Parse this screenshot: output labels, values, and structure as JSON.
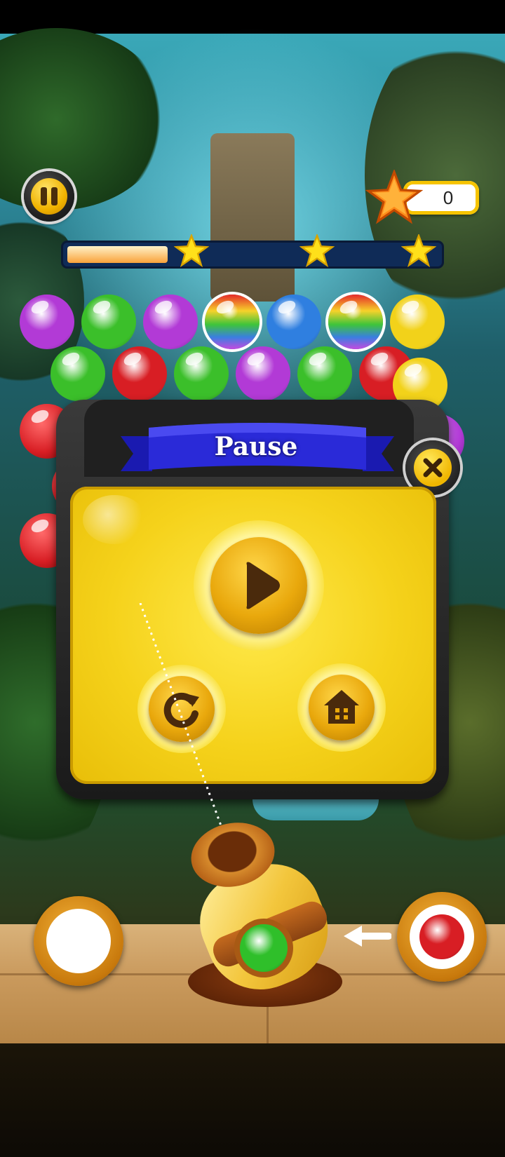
{
  "hud": {
    "score": "0",
    "progress": 0.27,
    "progress_stars": 3
  },
  "bubbles": [
    {
      "color": "#b23ad6",
      "row": 0,
      "col": 0
    },
    {
      "color": "#3bbf2a",
      "row": 0,
      "col": 1
    },
    {
      "color": "#b23ad6",
      "row": 0,
      "col": 2
    },
    {
      "color": "rainbow",
      "row": 0,
      "col": 3
    },
    {
      "color": "#2f7fe0",
      "row": 0,
      "col": 4
    },
    {
      "color": "rainbow",
      "row": 0,
      "col": 5
    },
    {
      "color": "#f2d21a",
      "row": 0,
      "col": 6
    },
    {
      "color": "#3bbf2a",
      "row": 1,
      "col": 0
    },
    {
      "color": "#d81e24",
      "row": 1,
      "col": 1
    },
    {
      "color": "#3bbf2a",
      "row": 1,
      "col": 2
    },
    {
      "color": "#b23ad6",
      "row": 1,
      "col": 3
    },
    {
      "color": "#3bbf2a",
      "row": 1,
      "col": 4
    },
    {
      "color": "#d81e24",
      "row": 1,
      "col": 5
    },
    {
      "color": "#f2d21a",
      "row": 1,
      "col": 6
    }
  ],
  "pause_dialog": {
    "title": "Pause",
    "resume_icon": "play-icon",
    "restart_icon": "restart-icon",
    "home_icon": "home-icon",
    "close_icon": "close-icon"
  },
  "shooter": {
    "current_ball_color": "#2fbf2a",
    "next_ball_color": "#d81e24",
    "swap_slot_color": "#ffffff"
  },
  "colors": {
    "accent_yellow": "#f5d21b",
    "ribbon_blue": "#2a2ad0",
    "progress_track": "#0f2b57"
  }
}
